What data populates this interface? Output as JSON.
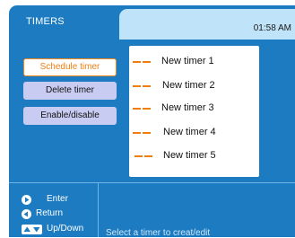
{
  "header": {
    "title": "TIMERS",
    "clock": "01:58 AM"
  },
  "menu": {
    "schedule": "Schedule timer",
    "delete": "Delete timer",
    "enable": "Enable/disable"
  },
  "timers": [
    "New timer 1",
    "New timer 2",
    "New timer 3",
    "New timer 4",
    "New timer 5"
  ],
  "footer": {
    "enter": "Enter",
    "return": "Return",
    "updown": "Up/Down",
    "hint": "Select a timer to creat/edit"
  },
  "colors": {
    "panel": "#1d7cc1",
    "accent": "#f07d10",
    "clock_bar": "#bfe3f8",
    "menu_button": "#c8ccf2"
  }
}
